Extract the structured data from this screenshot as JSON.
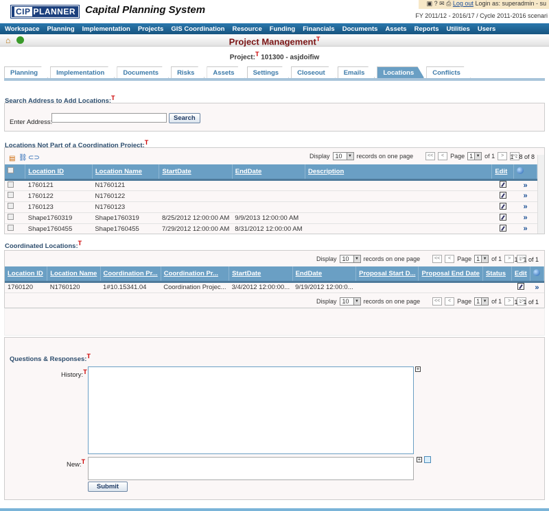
{
  "header": {
    "logo_left": "CIP",
    "logo_right": "PLANNER",
    "app_title": "Capital Planning System",
    "logout": "Log out",
    "login_as": "Login as: superadmin - su",
    "fiscal": "FY 2011/12 - 2016/17 / Cycle 2011-2016 scenari"
  },
  "nav": [
    "Workspace",
    "Planning",
    "Implementation",
    "Projects",
    "GIS Coordination",
    "Resource",
    "Funding",
    "Financials",
    "Documents",
    "Assets",
    "Reports",
    "Utilities",
    "Users"
  ],
  "page": {
    "title": "Project Management",
    "t": "T",
    "project_label": "Project:",
    "project_value": "101300 - asjdoifiw"
  },
  "tabs": [
    {
      "label": "Planning"
    },
    {
      "label": "Implementation"
    },
    {
      "label": "Documents"
    },
    {
      "label": "Risks"
    },
    {
      "label": "Assets"
    },
    {
      "label": "Settings"
    },
    {
      "label": "Closeout"
    },
    {
      "label": "Emails"
    },
    {
      "label": "Locations",
      "active": true
    },
    {
      "label": "Conflicts"
    }
  ],
  "search": {
    "section": "Search Address to Add Locations:",
    "label": "Enter Address:",
    "value": "",
    "button": "Search"
  },
  "pager": {
    "display": "Display",
    "size": "10",
    "records": "records on one page",
    "page": "Page",
    "page_num": "1",
    "of": "of 1"
  },
  "locations": {
    "section": "Locations Not Part of a Coordination Project:",
    "count": "1 - 8 of 8",
    "columns": [
      "Location ID",
      "Location Name",
      "StartDate",
      "EndDate",
      "Description",
      "Edit"
    ],
    "rows": [
      [
        "1760121",
        "N1760121",
        "",
        "",
        ""
      ],
      [
        "1760122",
        "N1760122",
        "",
        "",
        ""
      ],
      [
        "1760123",
        "N1760123",
        "",
        "",
        ""
      ],
      [
        "Shape1760319",
        "Shape1760319",
        "8/25/2012 12:00:00 AM",
        "9/9/2013 12:00:00 AM",
        ""
      ],
      [
        "Shape1760455",
        "Shape1760455",
        "7/29/2012 12:00:00 AM",
        "8/31/2012 12:00:00 AM",
        ""
      ]
    ]
  },
  "coordinated": {
    "section": "Coordinated Locations:",
    "count": "1 - 1 of 1",
    "columns": [
      "Location ID",
      "Location Name",
      "Coordination Pr...",
      "Coordination Pr...",
      "StartDate",
      "EndDate",
      "Proposal Start D...",
      "Proposal End Date",
      "Status",
      "Edit"
    ],
    "rows": [
      [
        "1760120",
        "N1760120",
        "1#10.15341.04",
        "Coordination Projec...",
        "3/4/2012 12:00:00...",
        "9/19/2012 12:00:0...",
        "",
        "",
        ""
      ]
    ]
  },
  "qr": {
    "section": "Questions & Responses:",
    "history": "History:",
    "new": "New:",
    "submit": "Submit"
  }
}
